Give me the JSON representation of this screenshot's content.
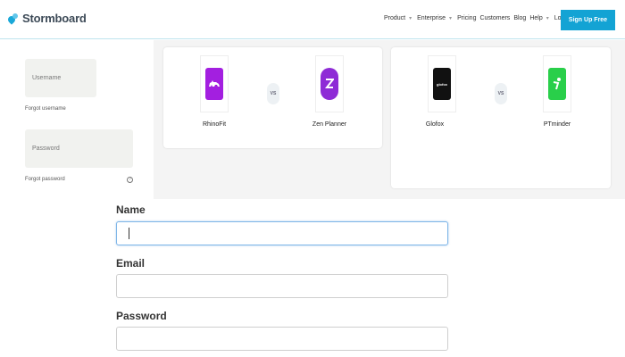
{
  "header": {
    "brand": "Stormboard",
    "nav": [
      "Product",
      "Enterprise",
      "Pricing",
      "Customers",
      "Blog",
      "Help",
      "Login →"
    ],
    "signup_label": "Sign Up Free"
  },
  "login_panel": {
    "username_placeholder": "Username",
    "forgot_username": "Forgot username",
    "password_placeholder": "Password",
    "forgot_password": "Forgot password",
    "help_glyph": "?"
  },
  "comparisons": [
    {
      "left": {
        "name": "RhinoFit",
        "color": "#a31fe0",
        "icon": "rhino-icon"
      },
      "vs": "VS",
      "right": {
        "name": "Zen Planner",
        "color": "#8e2bd6",
        "icon": "zen-planner-icon"
      }
    },
    {
      "left": {
        "name": "Glofox",
        "color": "#111111",
        "icon": "glofox-icon",
        "logo_text": "glofox"
      },
      "vs": "VS",
      "right": {
        "name": "PTminder",
        "color": "#29cf4a",
        "icon": "ptminder-icon"
      }
    }
  ],
  "form": {
    "name_label": "Name",
    "email_label": "Email",
    "password_label": "Password",
    "name_value": "",
    "email_value": "",
    "password_value": ""
  }
}
